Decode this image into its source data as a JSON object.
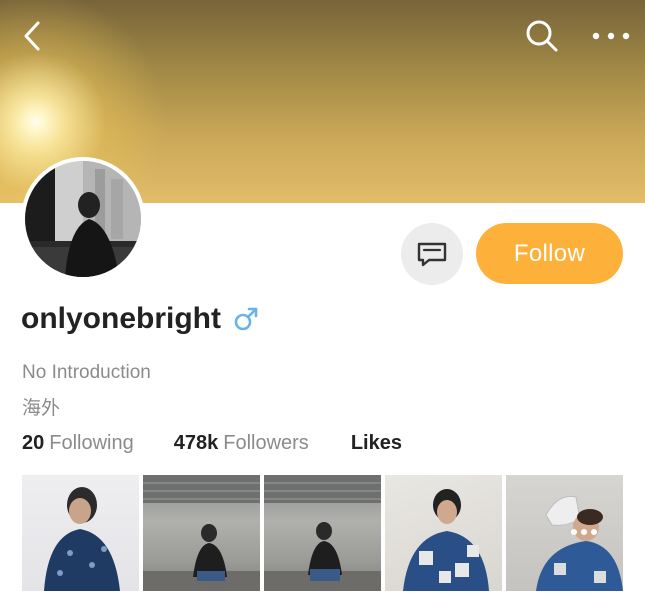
{
  "header": {
    "back_icon": "chevron-left-icon",
    "search_icon": "search-icon",
    "more_icon": "more-horizontal-icon"
  },
  "profile": {
    "username": "onlyonebright",
    "gender_icon": "male-symbol-icon",
    "introduction": "No Introduction",
    "region": "海外",
    "follow_label": "Follow",
    "message_icon": "message-icon"
  },
  "stats": {
    "following_count": "20",
    "following_label": "Following",
    "followers_count": "478k",
    "followers_label": "Followers",
    "likes_label": "Likes"
  },
  "colors": {
    "accent": "#fdb13a",
    "gender_blue": "#6ab3e6",
    "muted_text": "#8b8b8b"
  },
  "posts": [
    {
      "type": "photo"
    },
    {
      "type": "photo"
    },
    {
      "type": "photo"
    },
    {
      "type": "photo"
    },
    {
      "type": "photo",
      "multi_image": true
    }
  ]
}
